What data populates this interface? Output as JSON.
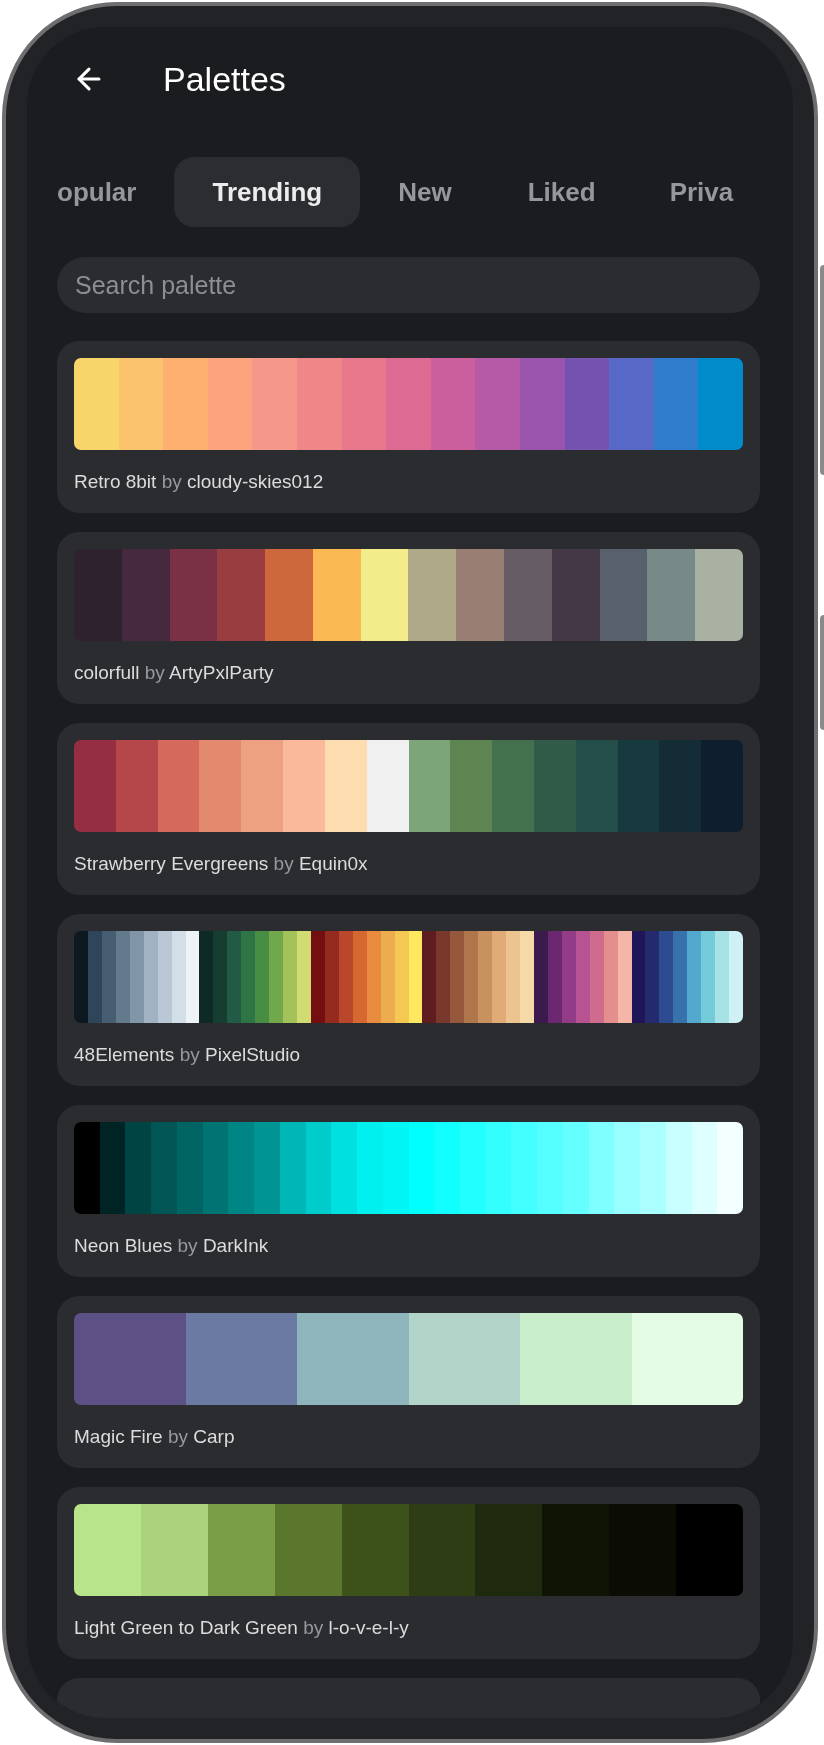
{
  "header": {
    "title": "Palettes"
  },
  "tabs": [
    {
      "label": "opular",
      "selected": false
    },
    {
      "label": "Trending",
      "selected": true
    },
    {
      "label": "New",
      "selected": false
    },
    {
      "label": "Liked",
      "selected": false
    },
    {
      "label": "Priva",
      "selected": false
    }
  ],
  "search": {
    "placeholder": "Search palette"
  },
  "palettes": [
    {
      "name": "Retro 8bit",
      "by_label": "by",
      "author": "cloudy-skies012",
      "swatches": [
        {
          "color": "#f7d56b"
        },
        {
          "color": "#fbc46c"
        },
        {
          "color": "#fdb06f"
        },
        {
          "color": "#fda47f"
        },
        {
          "color": "#f5988a"
        },
        {
          "color": "#ef8688"
        },
        {
          "color": "#e8778c"
        },
        {
          "color": "#dc6a92"
        },
        {
          "color": "#cb5e9c"
        },
        {
          "color": "#b65aa6"
        },
        {
          "color": "#9954ac"
        },
        {
          "color": "#7652b0"
        },
        {
          "color": "#5768c6"
        },
        {
          "color": "#2f7ccb"
        },
        {
          "color": "#028bcb"
        }
      ]
    },
    {
      "name": "colorfull",
      "by_label": "by",
      "author": "ArtyPxlParty",
      "swatches": [
        {
          "color": "#2e222f"
        },
        {
          "color": "#45293f"
        },
        {
          "color": "#7a3045"
        },
        {
          "color": "#993d41"
        },
        {
          "color": "#cd683d"
        },
        {
          "color": "#fbb954"
        },
        {
          "color": "#f2ec8b"
        },
        {
          "color": "#b0a987"
        },
        {
          "color": "#997f73"
        },
        {
          "color": "#665c64"
        },
        {
          "color": "#443846"
        },
        {
          "color": "#58616b"
        },
        {
          "color": "#778a87"
        },
        {
          "color": "#a8b1a2"
        }
      ]
    },
    {
      "name": "Strawberry Evergreens",
      "by_label": "by",
      "author": "Equin0x",
      "swatches": [
        {
          "color": "#962e42"
        },
        {
          "color": "#b5474a"
        },
        {
          "color": "#d5695b"
        },
        {
          "color": "#e38a6e"
        },
        {
          "color": "#eda180"
        },
        {
          "color": "#f9b99a"
        },
        {
          "color": "#fddcb0"
        },
        {
          "color": "#f0f0f0"
        },
        {
          "color": "#7ca57a"
        },
        {
          "color": "#5e8452"
        },
        {
          "color": "#43704d"
        },
        {
          "color": "#2f5b48"
        },
        {
          "color": "#244e4a"
        },
        {
          "color": "#173a40"
        },
        {
          "color": "#132c36"
        },
        {
          "color": "#0f1e2e"
        }
      ]
    },
    {
      "name": "48Elements",
      "by_label": "by",
      "author": "PixelStudio",
      "swatches": [
        {
          "color": "#0d1820"
        },
        {
          "color": "#2f4559"
        },
        {
          "color": "#475e72"
        },
        {
          "color": "#637a8c"
        },
        {
          "color": "#8096a7"
        },
        {
          "color": "#a1b3c2"
        },
        {
          "color": "#bac8d5"
        },
        {
          "color": "#d3dfe6"
        },
        {
          "color": "#eef3f7"
        },
        {
          "color": "#0e2a26"
        },
        {
          "color": "#153d32"
        },
        {
          "color": "#215a45"
        },
        {
          "color": "#2d7544"
        },
        {
          "color": "#478e44"
        },
        {
          "color": "#72a84c"
        },
        {
          "color": "#a4c25a"
        },
        {
          "color": "#d0dc72"
        },
        {
          "color": "#730f11"
        },
        {
          "color": "#952a1f"
        },
        {
          "color": "#b9472b"
        },
        {
          "color": "#d46830"
        },
        {
          "color": "#e98c40"
        },
        {
          "color": "#ecad4f"
        },
        {
          "color": "#f5c753"
        },
        {
          "color": "#fee761"
        },
        {
          "color": "#5e1e20"
        },
        {
          "color": "#7a372c"
        },
        {
          "color": "#95583c"
        },
        {
          "color": "#af764c"
        },
        {
          "color": "#c8915d"
        },
        {
          "color": "#e0ab76"
        },
        {
          "color": "#ebc48f"
        },
        {
          "color": "#f5d9a6"
        },
        {
          "color": "#3c1a4c"
        },
        {
          "color": "#6b2770"
        },
        {
          "color": "#923b86"
        },
        {
          "color": "#b85393"
        },
        {
          "color": "#cf6b8c"
        },
        {
          "color": "#e58e8e"
        },
        {
          "color": "#f4b6a8"
        },
        {
          "color": "#1f1657"
        },
        {
          "color": "#25296e"
        },
        {
          "color": "#2d4b91"
        },
        {
          "color": "#3772ad"
        },
        {
          "color": "#52a8cf"
        },
        {
          "color": "#74cbd9"
        },
        {
          "color": "#a7e2e6"
        },
        {
          "color": "#cff0f4"
        }
      ]
    },
    {
      "name": "Neon Blues",
      "by_label": "by",
      "author": "DarkInk",
      "swatches": [
        {
          "color": "#000000"
        },
        {
          "color": "#002424"
        },
        {
          "color": "#004444"
        },
        {
          "color": "#005555"
        },
        {
          "color": "#006464"
        },
        {
          "color": "#007373"
        },
        {
          "color": "#008585"
        },
        {
          "color": "#009494"
        },
        {
          "color": "#00b6b6"
        },
        {
          "color": "#00cccc"
        },
        {
          "color": "#00e0e0"
        },
        {
          "color": "#00f0f0"
        },
        {
          "color": "#00f5f5"
        },
        {
          "color": "#00ffff"
        },
        {
          "color": "#11ffff"
        },
        {
          "color": "#22ffff"
        },
        {
          "color": "#33ffff"
        },
        {
          "color": "#44ffff"
        },
        {
          "color": "#55ffff"
        },
        {
          "color": "#66ffff"
        },
        {
          "color": "#7fffff"
        },
        {
          "color": "#99ffff"
        },
        {
          "color": "#aaffff"
        },
        {
          "color": "#c8ffff"
        },
        {
          "color": "#ddffff"
        },
        {
          "color": "#f4ffff"
        }
      ]
    },
    {
      "name": "Magic Fire",
      "by_label": "by",
      "author": "Carp",
      "swatches": [
        {
          "color": "#5c5084"
        },
        {
          "color": "#6a7aa2"
        },
        {
          "color": "#8eb4bc"
        },
        {
          "color": "#b2d4c8"
        },
        {
          "color": "#c9eecb"
        },
        {
          "color": "#e4fce3"
        }
      ]
    },
    {
      "name": "Light Green to Dark Green",
      "by_label": "by",
      "author": "l-o-v-e-l-y",
      "swatches": [
        {
          "color": "#b8e58a"
        },
        {
          "color": "#abd37e"
        },
        {
          "color": "#7a9e45"
        },
        {
          "color": "#5b772d"
        },
        {
          "color": "#3d521b"
        },
        {
          "color": "#2f3d14"
        },
        {
          "color": "#1e290d"
        },
        {
          "color": "#0f1405"
        },
        {
          "color": "#0b0d04"
        },
        {
          "color": "#000000"
        }
      ]
    }
  ]
}
